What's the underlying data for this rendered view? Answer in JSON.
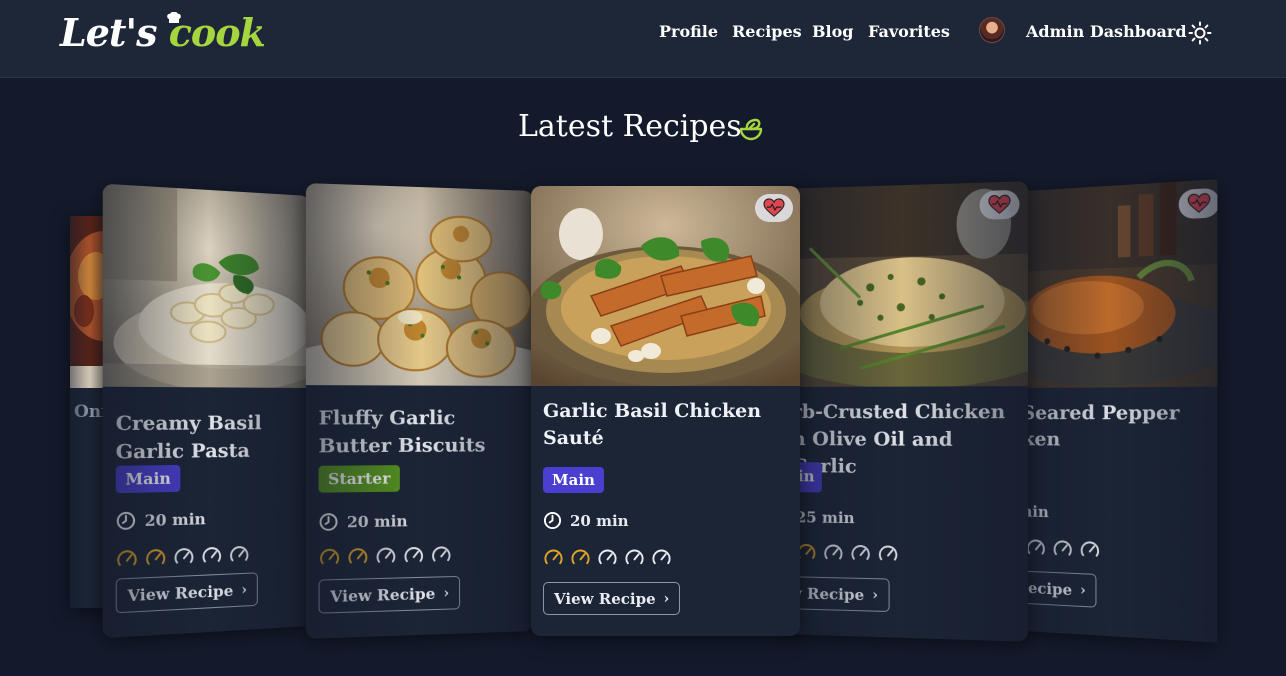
{
  "brand": {
    "logo_part1": "Let's ",
    "logo_part2": "cook"
  },
  "nav": {
    "links": [
      "Profile",
      "Recipes",
      "Blog",
      "Favorites"
    ],
    "admin": "Admin Dashboard"
  },
  "colors": {
    "accent": "#a5d63f",
    "main_badge": "#4b3fd1",
    "starter_badge": "#5a9a1e",
    "difficulty_active": "#e0a526"
  },
  "icons": {
    "theme_toggle": "sun-icon",
    "heading_icon": "salad-bowl-icon",
    "favorite": "heart-pulse-icon",
    "time": "clock-icon",
    "difficulty": "gauge-icon"
  },
  "section": {
    "heading": "Latest Recipes"
  },
  "cards": [
    {
      "title": "Onio",
      "category": "",
      "time": "",
      "difficulty": 0,
      "button": ""
    },
    {
      "title": "Creamy Basil Garlic Pasta",
      "category": "Main",
      "time": "20 min",
      "difficulty": 2,
      "button": "View Recipe"
    },
    {
      "title": "Fluffy Garlic Butter Biscuits",
      "category": "Starter",
      "time": "20 min",
      "difficulty": 2,
      "button": "View Recipe"
    },
    {
      "title": "Garlic Basil Chicken Sauté",
      "category": "Main",
      "time": "20 min",
      "difficulty": 2,
      "button": "View Recipe"
    },
    {
      "title": "rb-Crusted Chicken h Olive Oil and Garlic",
      "category": "in",
      "time": "25 min",
      "difficulty": 2,
      "button": "w Recipe"
    },
    {
      "title": "Seared Pepper ken",
      "category": "",
      "time": "nin",
      "difficulty": 0,
      "button": "Recipe"
    }
  ],
  "difficulty_max": 5
}
